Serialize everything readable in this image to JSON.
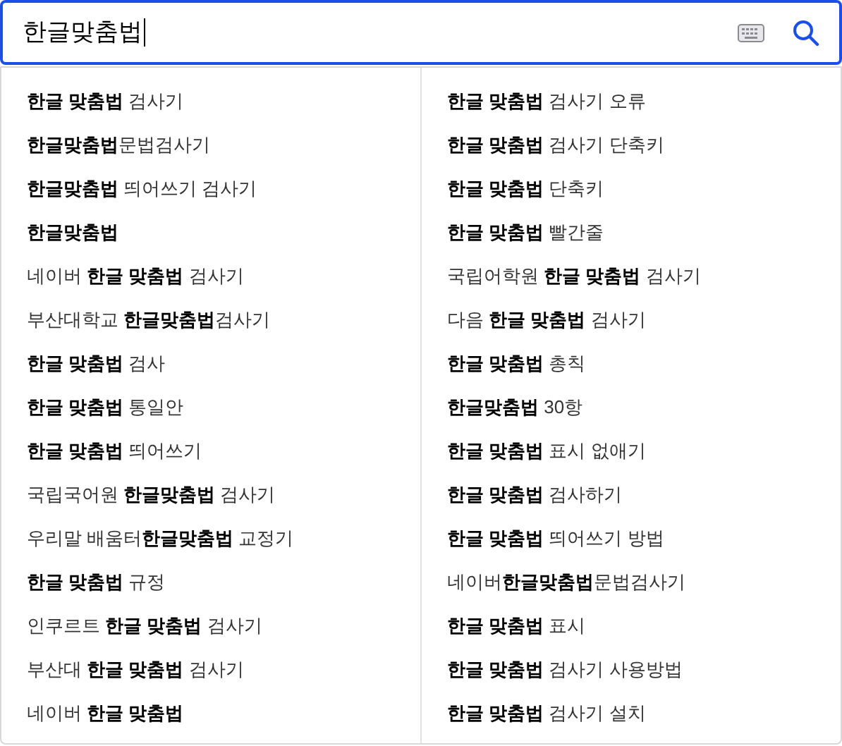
{
  "search": {
    "value": "한글맞춤법"
  },
  "suggestions": {
    "columns": [
      [
        "**한글 맞춤법** 검사기",
        "**한글맞춤법**문법검사기",
        "**한글맞춤법** 띄어쓰기 검사기",
        "**한글맞춤법**",
        "네이버 **한글 맞춤법** 검사기",
        "부산대학교 **한글맞춤법**검사기",
        "**한글 맞춤법** 검사",
        "**한글 맞춤법** 통일안",
        "**한글 맞춤법** 띄어쓰기",
        "국립국어원 **한글맞춤법** 검사기",
        "우리말 배움터**한글맞춤법** 교정기",
        "**한글 맞춤법** 규정",
        "인쿠르트 **한글 맞춤법** 검사기",
        "부산대 **한글 맞춤법** 검사기",
        "네이버 **한글 맞춤법**"
      ],
      [
        "**한글 맞춤법** 검사기 오류",
        "**한글 맞춤법** 검사기 단축키",
        "**한글 맞춤법** 단축키",
        "**한글 맞춤법** 빨간줄",
        "국립어학원 **한글 맞춤법** 검사기",
        "다음 **한글 맞춤법** 검사기",
        "**한글 맞춤법** 총칙",
        "**한글맞춤법** 30항",
        "**한글 맞춤법** 표시 없애기",
        "**한글 맞춤법** 검사하기",
        "**한글 맞춤법** 띄어쓰기 방법",
        "네이버**한글맞춤법**문법검사기",
        "**한글 맞춤법** 표시",
        "**한글 맞춤법** 검사기 사용방법",
        "**한글 맞춤법** 검사기 설치"
      ]
    ]
  }
}
